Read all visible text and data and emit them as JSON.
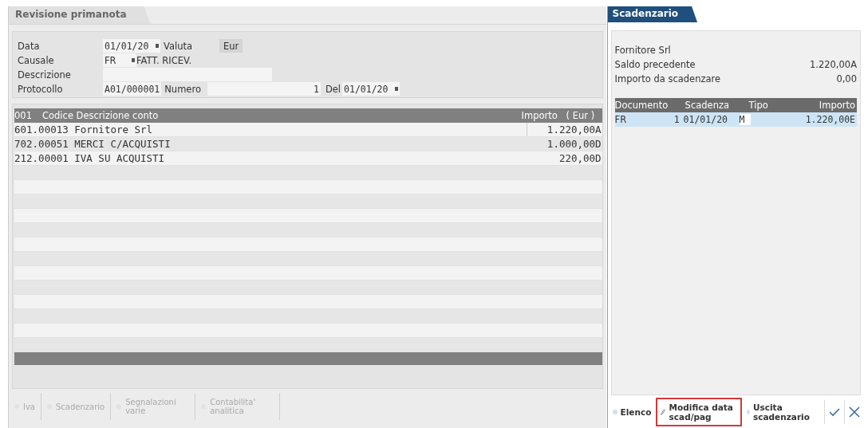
{
  "main": {
    "tab_title": "Revisione primanota",
    "form": {
      "data_label": "Data",
      "data_value": "01/01/20",
      "valuta_label": "Valuta",
      "valuta_value": "Eur",
      "causale_label": "Causale",
      "causale_code": "FR",
      "causale_desc": "FATT. RICEV.",
      "descrizione_label": "Descrizione",
      "protocollo_label": "Protocollo",
      "protocollo_value": "A01/000001",
      "numero_label": "Numero",
      "numero_value": "1",
      "del_label": "Del",
      "del_value": "01/01/20"
    },
    "grid": {
      "row_no": "001",
      "columns_label": "Codice Descrizione conto",
      "amount_label": "Importo",
      "currency_label": "( Eur )",
      "rows": [
        {
          "code": "601.00013",
          "description": "Fornitore Srl",
          "amount": "1.220,00A",
          "selected": true
        },
        {
          "code": "702.00051",
          "description": "MERCI C/ACQUISTI",
          "amount": "1.000,00D",
          "selected": false
        },
        {
          "code": "212.00001",
          "description": "IVA SU ACQUISTI",
          "amount": "220,00D",
          "selected": false
        }
      ]
    },
    "toolbar": [
      {
        "label": "Iva",
        "disabled": true
      },
      {
        "label": "Scadenzario",
        "disabled": true
      },
      {
        "label": "Segnalazioni varie",
        "disabled": true
      },
      {
        "label": "Contabilita' analitica",
        "disabled": true
      }
    ]
  },
  "scadenzario": {
    "tab_title": "Scadenzario",
    "supplier": "Fornitore Srl",
    "saldo_label": "Saldo precedente",
    "saldo_value": "1.220,00A",
    "importo_label": "Importo da scadenzare",
    "importo_value": "0,00",
    "columns": [
      "Documento",
      "Scadenza",
      "Tipo",
      "Importo"
    ],
    "rows": [
      {
        "documento": "FR",
        "numero": "1",
        "scadenza": "01/01/20",
        "tipo": "M",
        "importo": "1.220,00E",
        "selected": true
      }
    ],
    "toolbar": [
      {
        "label": "Elenco",
        "kind": "dot",
        "focused": false
      },
      {
        "label": "Modifica data scad/pag",
        "kind": "pencil",
        "focused": true
      },
      {
        "label": "Uscita scadenzario",
        "kind": "dot",
        "focused": false
      },
      {
        "kind": "confirm",
        "focused": false
      },
      {
        "kind": "cancel",
        "focused": false
      }
    ]
  }
}
